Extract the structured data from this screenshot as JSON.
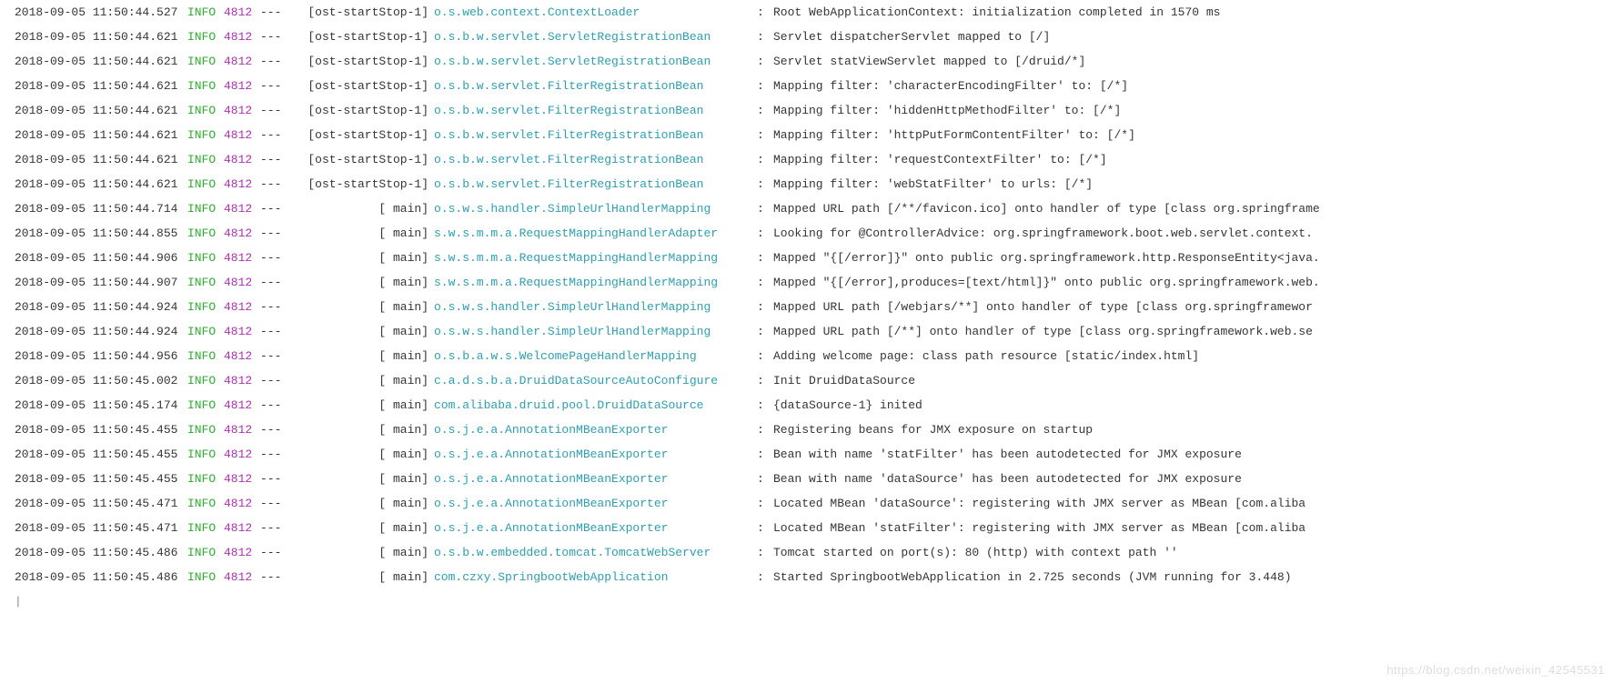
{
  "watermark": "https://blog.csdn.net/weixin_42545531",
  "log": {
    "level_label": "INFO",
    "pid": "4812",
    "separator": "---",
    "lines": [
      {
        "ts": "2018-09-05 11:50:44.527",
        "thread": "[ost-startStop-1]",
        "logger": "o.s.web.context.ContextLoader",
        "msg": "Root WebApplicationContext: initialization completed in 1570 ms"
      },
      {
        "ts": "2018-09-05 11:50:44.621",
        "thread": "[ost-startStop-1]",
        "logger": "o.s.b.w.servlet.ServletRegistrationBean",
        "msg": "Servlet dispatcherServlet mapped to [/]"
      },
      {
        "ts": "2018-09-05 11:50:44.621",
        "thread": "[ost-startStop-1]",
        "logger": "o.s.b.w.servlet.ServletRegistrationBean",
        "msg": "Servlet statViewServlet mapped to [/druid/*]"
      },
      {
        "ts": "2018-09-05 11:50:44.621",
        "thread": "[ost-startStop-1]",
        "logger": "o.s.b.w.servlet.FilterRegistrationBean",
        "msg": "Mapping filter: 'characterEncodingFilter' to: [/*]"
      },
      {
        "ts": "2018-09-05 11:50:44.621",
        "thread": "[ost-startStop-1]",
        "logger": "o.s.b.w.servlet.FilterRegistrationBean",
        "msg": "Mapping filter: 'hiddenHttpMethodFilter' to: [/*]"
      },
      {
        "ts": "2018-09-05 11:50:44.621",
        "thread": "[ost-startStop-1]",
        "logger": "o.s.b.w.servlet.FilterRegistrationBean",
        "msg": "Mapping filter: 'httpPutFormContentFilter' to: [/*]"
      },
      {
        "ts": "2018-09-05 11:50:44.621",
        "thread": "[ost-startStop-1]",
        "logger": "o.s.b.w.servlet.FilterRegistrationBean",
        "msg": "Mapping filter: 'requestContextFilter' to: [/*]"
      },
      {
        "ts": "2018-09-05 11:50:44.621",
        "thread": "[ost-startStop-1]",
        "logger": "o.s.b.w.servlet.FilterRegistrationBean",
        "msg": "Mapping filter: 'webStatFilter' to urls: [/*]"
      },
      {
        "ts": "2018-09-05 11:50:44.714",
        "thread": "[           main]",
        "logger": "o.s.w.s.handler.SimpleUrlHandlerMapping",
        "msg": "Mapped URL path [/**/favicon.ico] onto handler of type [class org.springframe"
      },
      {
        "ts": "2018-09-05 11:50:44.855",
        "thread": "[           main]",
        "logger": "s.w.s.m.m.a.RequestMappingHandlerAdapter",
        "msg": "Looking for @ControllerAdvice: org.springframework.boot.web.servlet.context."
      },
      {
        "ts": "2018-09-05 11:50:44.906",
        "thread": "[           main]",
        "logger": "s.w.s.m.m.a.RequestMappingHandlerMapping",
        "msg": "Mapped \"{[/error]}\" onto public org.springframework.http.ResponseEntity<java."
      },
      {
        "ts": "2018-09-05 11:50:44.907",
        "thread": "[           main]",
        "logger": "s.w.s.m.m.a.RequestMappingHandlerMapping",
        "msg": "Mapped \"{[/error],produces=[text/html]}\" onto public org.springframework.web."
      },
      {
        "ts": "2018-09-05 11:50:44.924",
        "thread": "[           main]",
        "logger": "o.s.w.s.handler.SimpleUrlHandlerMapping",
        "msg": "Mapped URL path [/webjars/**] onto handler of type [class org.springframewor"
      },
      {
        "ts": "2018-09-05 11:50:44.924",
        "thread": "[           main]",
        "logger": "o.s.w.s.handler.SimpleUrlHandlerMapping",
        "msg": "Mapped URL path [/**] onto handler of type [class org.springframework.web.se"
      },
      {
        "ts": "2018-09-05 11:50:44.956",
        "thread": "[           main]",
        "logger": "o.s.b.a.w.s.WelcomePageHandlerMapping",
        "msg": "Adding welcome page: class path resource [static/index.html]"
      },
      {
        "ts": "2018-09-05 11:50:45.002",
        "thread": "[           main]",
        "logger": "c.a.d.s.b.a.DruidDataSourceAutoConfigure",
        "msg": "Init DruidDataSource"
      },
      {
        "ts": "2018-09-05 11:50:45.174",
        "thread": "[           main]",
        "logger": "com.alibaba.druid.pool.DruidDataSource",
        "msg": "{dataSource-1} inited"
      },
      {
        "ts": "2018-09-05 11:50:45.455",
        "thread": "[           main]",
        "logger": "o.s.j.e.a.AnnotationMBeanExporter",
        "msg": "Registering beans for JMX exposure on startup"
      },
      {
        "ts": "2018-09-05 11:50:45.455",
        "thread": "[           main]",
        "logger": "o.s.j.e.a.AnnotationMBeanExporter",
        "msg": "Bean with name 'statFilter' has been autodetected for JMX exposure"
      },
      {
        "ts": "2018-09-05 11:50:45.455",
        "thread": "[           main]",
        "logger": "o.s.j.e.a.AnnotationMBeanExporter",
        "msg": "Bean with name 'dataSource' has been autodetected for JMX exposure"
      },
      {
        "ts": "2018-09-05 11:50:45.471",
        "thread": "[           main]",
        "logger": "o.s.j.e.a.AnnotationMBeanExporter",
        "msg": "Located MBean 'dataSource': registering with JMX server as MBean [com.aliba"
      },
      {
        "ts": "2018-09-05 11:50:45.471",
        "thread": "[           main]",
        "logger": "o.s.j.e.a.AnnotationMBeanExporter",
        "msg": "Located MBean 'statFilter': registering with JMX server as MBean [com.aliba"
      },
      {
        "ts": "2018-09-05 11:50:45.486",
        "thread": "[           main]",
        "logger": "o.s.b.w.embedded.tomcat.TomcatWebServer",
        "msg": "Tomcat started on port(s): 80 (http) with context path ''"
      },
      {
        "ts": "2018-09-05 11:50:45.486",
        "thread": "[           main]",
        "logger": "com.czxy.SpringbootWebApplication",
        "msg": "Started SpringbootWebApplication in 2.725 seconds (JVM running for 3.448)"
      }
    ]
  }
}
